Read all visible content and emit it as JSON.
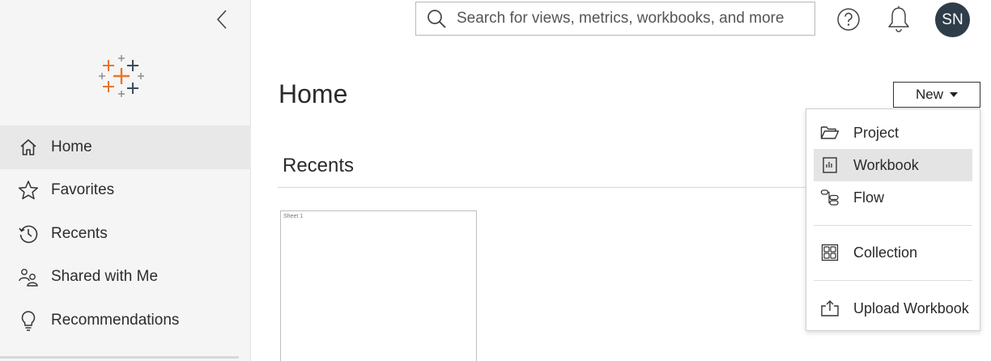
{
  "sidebar": {
    "items": [
      {
        "label": "Home",
        "icon": "home-icon",
        "active": true
      },
      {
        "label": "Favorites",
        "icon": "star-icon",
        "active": false
      },
      {
        "label": "Recents",
        "icon": "clock-history-icon",
        "active": false
      },
      {
        "label": "Shared with Me",
        "icon": "shared-users-icon",
        "active": false
      },
      {
        "label": "Recommendations",
        "icon": "lightbulb-icon",
        "active": false
      }
    ]
  },
  "header": {
    "search_placeholder": "Search for views, metrics, workbooks, and more",
    "avatar_initials": "SN"
  },
  "main": {
    "title": "Home",
    "new_label": "New",
    "recents_title": "Recents",
    "recent_cards": [
      {
        "label": "Sheet 1"
      }
    ]
  },
  "new_menu": {
    "items": [
      {
        "label": "Project",
        "icon": "folder-open-icon",
        "selected": false
      },
      {
        "label": "Workbook",
        "icon": "workbook-icon",
        "selected": true
      },
      {
        "label": "Flow",
        "icon": "flow-icon",
        "selected": false
      },
      {
        "label": "Collection",
        "icon": "collection-icon",
        "selected": false
      },
      {
        "label": "Upload Workbook",
        "icon": "upload-icon",
        "selected": false
      }
    ]
  },
  "colors": {
    "sidebar_bg": "#f5f5f5",
    "active_item_bg": "#e8e8e8",
    "avatar_bg": "#2e3d49",
    "logo_orange": "#e8762d",
    "logo_dark": "#3b4b5c"
  }
}
